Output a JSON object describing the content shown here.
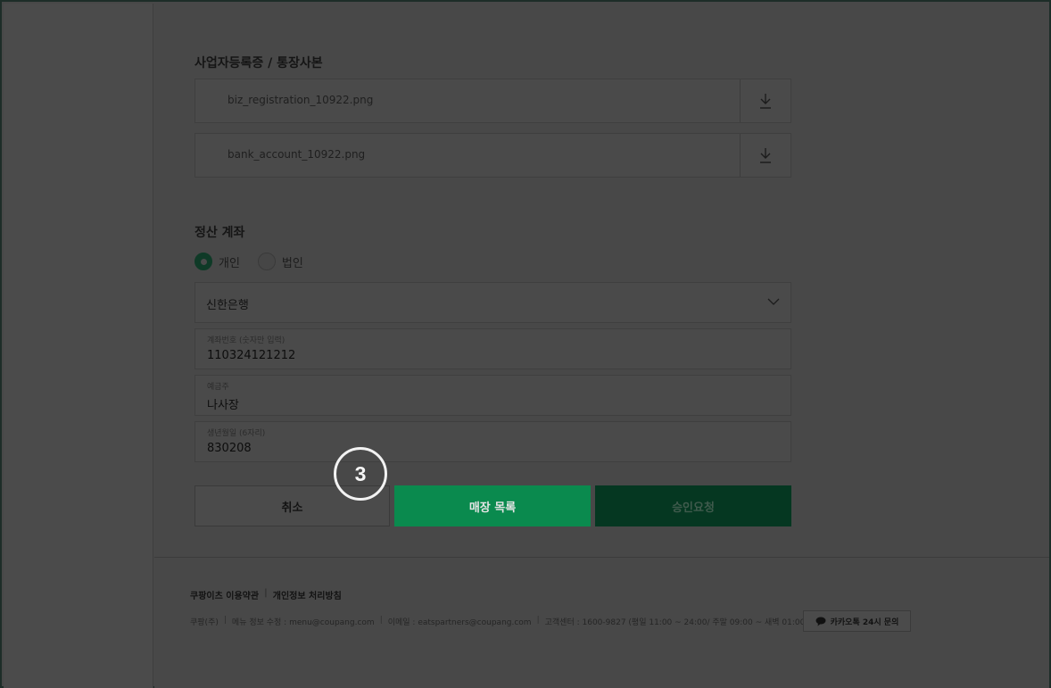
{
  "documents": {
    "title": "사업자등록증 / 통장사본",
    "files": [
      {
        "name": "biz_registration_10922.png"
      },
      {
        "name": "bank_account_10922.png"
      }
    ]
  },
  "settlement": {
    "title": "정산 계좌",
    "account_type_options": [
      {
        "label": "개인",
        "selected": true
      },
      {
        "label": "법인",
        "selected": false
      }
    ],
    "bank": {
      "selected": "신한은행"
    },
    "account_number": {
      "label": "계좌번호 (숫자만 입력)",
      "value": "110324121212"
    },
    "holder": {
      "label": "예금주",
      "value": "나사장"
    },
    "birth": {
      "label": "생년월일 (6자리)",
      "value": "830208"
    }
  },
  "actions": {
    "cancel_label": "취소",
    "store_list_label": "매장 목록",
    "approve_label": "승인요청"
  },
  "step_badge": "3",
  "footer": {
    "links": [
      "쿠팡이츠 이용약관",
      "개인정보 처리방침"
    ],
    "link_separator": "|",
    "info": [
      "쿠팡(주)",
      "메뉴 정보 수정 : menu@coupang.com",
      "이메일 : eatspartners@coupang.com",
      "고객센터 : 1600-9827 (평일 11:00 ~ 24:00/ 주말 09:00 ~ 새벽 01:00)"
    ],
    "kakao_label": "카카오톡 24시 문의"
  },
  "colors": {
    "accent_green": "#0a8a4e",
    "dark_green": "#053721",
    "overlay_bg": "#484848"
  },
  "icons": {
    "download": "download-icon",
    "chevron": "chevron-down-icon",
    "chat": "chat-bubble-icon"
  }
}
